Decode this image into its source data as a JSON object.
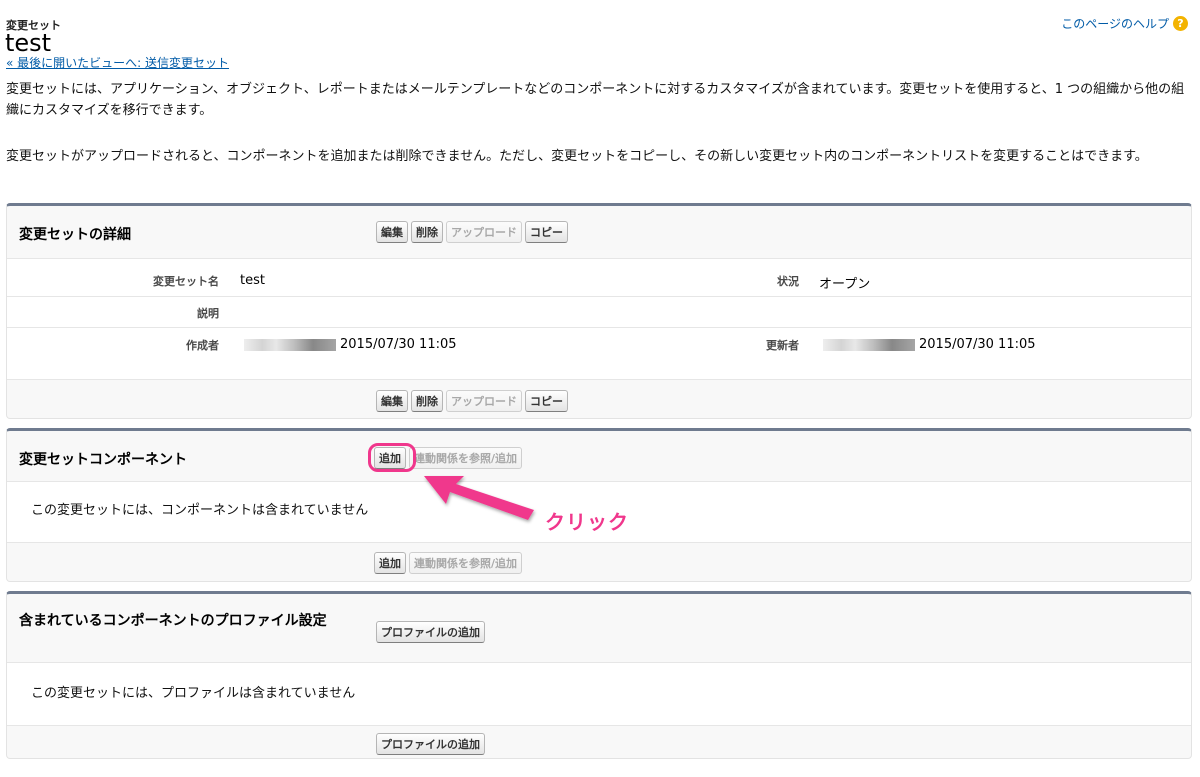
{
  "header": {
    "kicker": "変更セット",
    "title": "test",
    "back_link": "« 最後に開いたビューへ: 送信変更セット",
    "help_link": "このページのヘルプ",
    "help_icon": "?"
  },
  "intro": {
    "paragraph1": "変更セットには、アプリケーション、オブジェクト、レポートまたはメールテンプレートなどのコンポーネントに対するカスタマイズが含まれています。変更セットを使用すると、1 つの組織から他の組織にカスタマイズを移行できます。",
    "paragraph2": "変更セットがアップロードされると、コンポーネントを追加または削除できません。ただし、変更セットをコピーし、その新しい変更セット内のコンポーネントリストを変更することはできます。"
  },
  "details": {
    "title": "変更セットの詳細",
    "buttons": {
      "edit": "編集",
      "delete": "削除",
      "upload": "アップロード",
      "copy": "コピー"
    },
    "fields": {
      "name_label": "変更セット名",
      "name_value": "test",
      "status_label": "状況",
      "status_value": "オープン",
      "description_label": "説明",
      "created_by_label": "作成者",
      "created_by_date": "2015/07/30 11:05",
      "modified_by_label": "更新者",
      "modified_by_date": "2015/07/30 11:05"
    }
  },
  "components": {
    "title": "変更セットコンポーネント",
    "add_button": "追加",
    "deps_button": "連動関係を参照/追加",
    "empty_text": "この変更セットには、コンポーネントは含まれていません"
  },
  "profiles": {
    "title": "含まれているコンポーネントのプロファイル設定",
    "add_button": "プロファイルの追加",
    "empty_text": "この変更セットには、プロファイルは含まれていません"
  },
  "annotation": {
    "callout_text": "クリック",
    "color": "#f0378c"
  }
}
